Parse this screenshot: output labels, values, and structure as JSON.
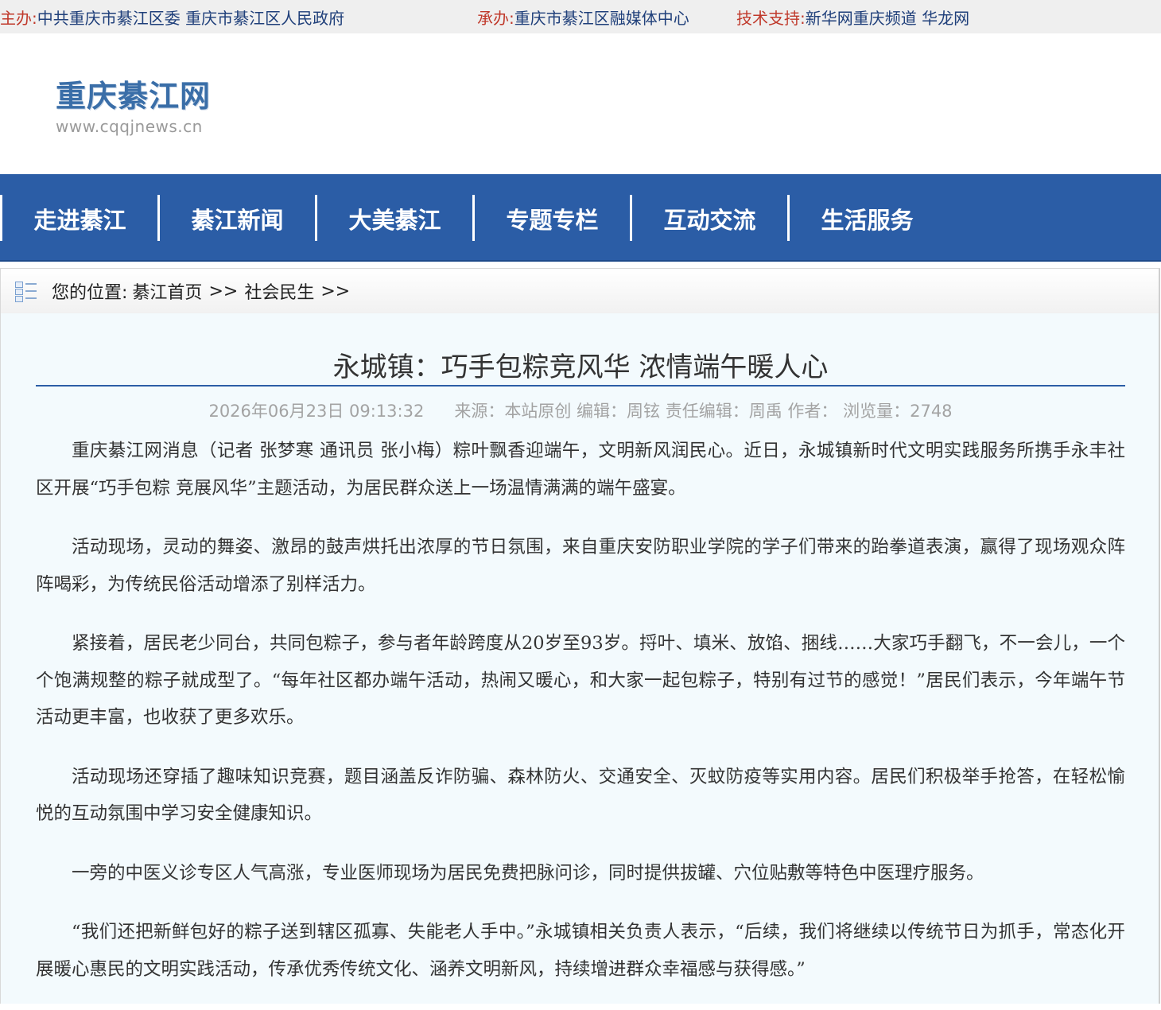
{
  "topbar": {
    "host_label": "主办:",
    "host_value": "中共重庆市綦江区委 重庆市綦江区人民政府",
    "organizer_label": "承办:",
    "organizer_value": "重庆市綦江区融媒体中心",
    "support_label": "技术支持:",
    "support_value": "新华网重庆频道 华龙网"
  },
  "logo": {
    "title": "重庆綦江网",
    "subtitle": "www.cqqjnews.cn"
  },
  "nav": {
    "items": [
      {
        "label": "走进綦江"
      },
      {
        "label": "綦江新闻"
      },
      {
        "label": "大美綦江"
      },
      {
        "label": "专题专栏"
      },
      {
        "label": "互动交流"
      },
      {
        "label": "生活服务"
      }
    ]
  },
  "breadcrumb": {
    "prefix": "您的位置:",
    "home": "綦江首页",
    "sep1": ">>",
    "section": "社会民生",
    "sep2": ">>"
  },
  "article": {
    "title": "永城镇：巧手包粽竞风华 浓情端午暖人心",
    "date": "2026年06月23日 09:13:32",
    "source_label": "来源：",
    "source": "本站原创",
    "editor_label": "编辑：",
    "editor": "周铉",
    "chief_editor_label": "责任编辑：",
    "chief_editor": "周禹",
    "author_label": "作者：",
    "author": "",
    "views_label": "浏览量：",
    "views": "2748",
    "paragraphs": [
      "重庆綦江网消息（记者 张梦寒 通讯员 张小梅）粽叶飘香迎端午，文明新风润民心。近日，永城镇新时代文明实践服务所携手永丰社区开展“巧手包粽 竞展风华”主题活动，为居民群众送上一场温情满满的端午盛宴。",
      "活动现场，灵动的舞姿、激昂的鼓声烘托出浓厚的节日氛围，来自重庆安防职业学院的学子们带来的跆拳道表演，赢得了现场观众阵阵喝彩，为传统民俗活动增添了别样活力。",
      "紧接着，居民老少同台，共同包粽子，参与者年龄跨度从20岁至93岁。捋叶、填米、放馅、捆线……大家巧手翻飞，不一会儿，一个个饱满规整的粽子就成型了。“每年社区都办端午活动，热闹又暖心，和大家一起包粽子，特别有过节的感觉！”居民们表示，今年端午节活动更丰富，也收获了更多欢乐。",
      "活动现场还穿插了趣味知识竞赛，题目涵盖反诈防骗、森林防火、交通安全、灭蚊防疫等实用内容。居民们积极举手抢答，在轻松愉悦的互动氛围中学习安全健康知识。",
      "一旁的中医义诊专区人气高涨，专业医师现场为居民免费把脉问诊，同时提供拔罐、穴位贴敷等特色中医理疗服务。",
      "“我们还把新鲜包好的粽子送到辖区孤寡、失能老人手中。”永城镇相关负责人表示，“后续，我们将继续以传统节日为抓手，常态化开展暖心惠民的文明实践活动，传承优秀传统文化、涵养文明新风，持续增进群众幸福感与获得感。”"
    ]
  }
}
